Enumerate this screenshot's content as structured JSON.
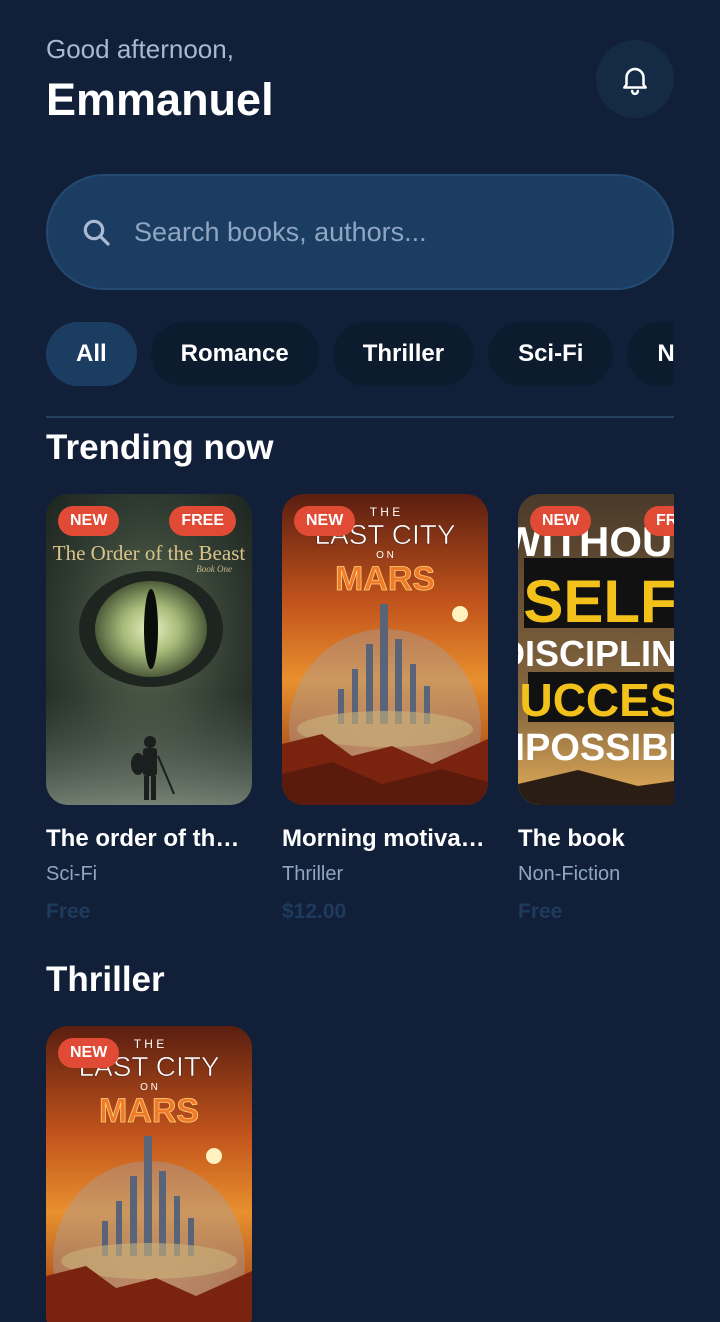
{
  "header": {
    "greeting": "Good afternoon,",
    "username": "Emmanuel"
  },
  "search": {
    "placeholder": "Search books, authors..."
  },
  "categories": [
    {
      "label": "All",
      "active": true
    },
    {
      "label": "Romance",
      "active": false
    },
    {
      "label": "Thriller",
      "active": false
    },
    {
      "label": "Sci-Fi",
      "active": false
    },
    {
      "label": "N",
      "active": false
    }
  ],
  "trending": {
    "title": "Trending now",
    "books": [
      {
        "title": "The order of the ...",
        "genre": "Sci-Fi",
        "price": "Free",
        "badge_new": "NEW",
        "badge_free": "FREE",
        "cover_text": "The Order of the Beast",
        "cover_subtext": "Book One"
      },
      {
        "title": "Morning motivat...",
        "genre": "Thriller",
        "price": "$12.00",
        "badge_new": "NEW",
        "cover_text_the": "T H E",
        "cover_text_city": "LAST CITY",
        "cover_text_on": "O N",
        "cover_text_mars": "MARS"
      },
      {
        "title": "The book",
        "genre": "Non-Fiction",
        "price": "Free",
        "badge_new": "NEW",
        "badge_free": "FREE",
        "cover_line1": "WITHOUT",
        "cover_line2": "SELF",
        "cover_line3": "DISCIPLINE",
        "cover_line4": "SUCCESS",
        "cover_line5": "IMPOSSIBLE"
      }
    ]
  },
  "thriller": {
    "title": "Thriller",
    "books": [
      {
        "badge_new": "NEW",
        "cover_text_the": "T H E",
        "cover_text_city": "LAST CITY",
        "cover_text_on": "O N",
        "cover_text_mars": "MARS"
      }
    ]
  },
  "colors": {
    "background": "#112038",
    "accent_chip": "#1c3d62",
    "badge": "#e14a35",
    "muted_text": "#8fa6c2"
  }
}
